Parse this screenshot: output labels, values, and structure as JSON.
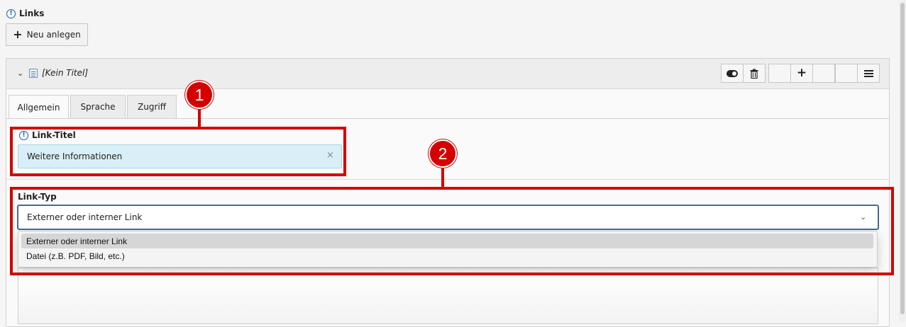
{
  "section": {
    "title": "Links",
    "icon": "info-circle-icon"
  },
  "new_button": {
    "label": "Neu anlegen",
    "icon": "plus-icon"
  },
  "record": {
    "title": "[Kein Titel]",
    "icons": [
      "chevron-down-icon",
      "record-icon"
    ],
    "toolbar": [
      "toggle-visibility-icon",
      "trash-icon",
      "plus-icon",
      "menu-icon"
    ]
  },
  "tabs": [
    {
      "label": "Allgemein",
      "active": true
    },
    {
      "label": "Sprache",
      "active": false
    },
    {
      "label": "Zugriff",
      "active": false
    }
  ],
  "link_title": {
    "label": "Link-Titel",
    "value": "Weitere Informationen",
    "clear_icon": "×"
  },
  "link_type": {
    "label": "Link-Typ",
    "selected": "Externer oder interner Link",
    "options": [
      "Externer oder interner Link",
      "Datei (z.B. PDF, Bild, etc.)"
    ]
  },
  "annotations": {
    "callout_1": "1",
    "callout_2": "2"
  },
  "colors": {
    "annotation_red": "#d40000",
    "field_changed_bg": "#d9eff7",
    "select_focus_border": "#4a6a8c"
  }
}
